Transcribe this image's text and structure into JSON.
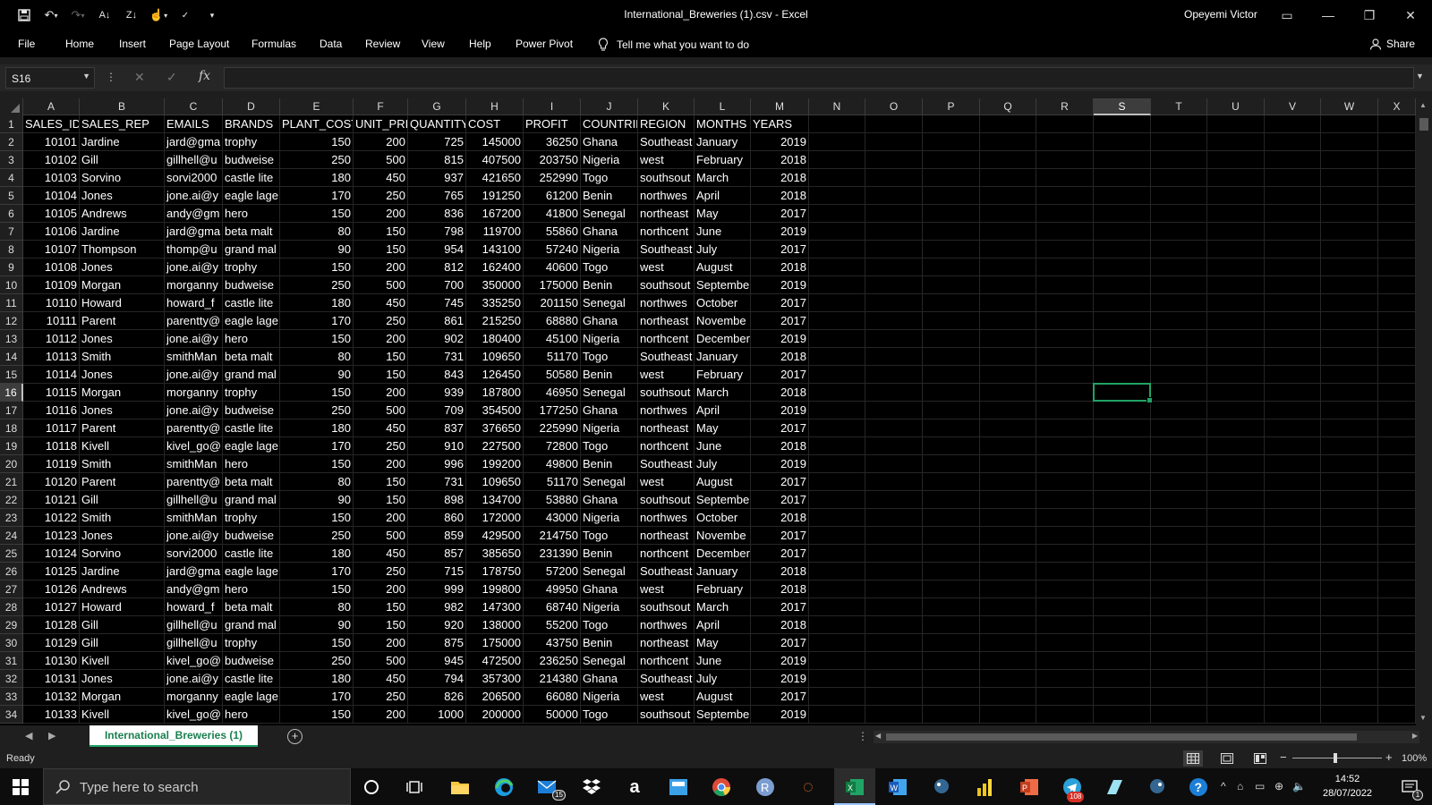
{
  "window": {
    "title": "International_Breweries (1).csv  -  Excel",
    "user": "Opeyemi Victor"
  },
  "ribbon_tabs": [
    "File",
    "Home",
    "Insert",
    "Page Layout",
    "Formulas",
    "Data",
    "Review",
    "View",
    "Help",
    "Power Pivot"
  ],
  "tell_me": "Tell me what you want to do",
  "share_label": "Share",
  "formula_bar": {
    "name_box": "S16",
    "formula": ""
  },
  "columns": [
    "A",
    "B",
    "C",
    "D",
    "E",
    "F",
    "G",
    "H",
    "I",
    "J",
    "K",
    "L",
    "M",
    "N",
    "O",
    "P",
    "Q",
    "R",
    "S",
    "T",
    "U",
    "V",
    "W",
    "X"
  ],
  "selected_column": "S",
  "selected_row": 16,
  "header_row": [
    "SALES_ID",
    "SALES_REP",
    "EMAILS",
    "BRANDS",
    "PLANT_COST",
    "UNIT_PRICE",
    "QUANTITY",
    "COST",
    "PROFIT",
    "COUNTRIES",
    "REGION",
    "MONTHS",
    "YEARS"
  ],
  "rows": [
    [
      "10101",
      "Jardine",
      "jard@gma",
      "trophy",
      "150",
      "200",
      "725",
      "145000",
      "36250",
      "Ghana",
      "Southeast",
      "January",
      "2019"
    ],
    [
      "10102",
      "Gill",
      "gillhell@u",
      "budweise",
      "250",
      "500",
      "815",
      "407500",
      "203750",
      "Nigeria",
      "west",
      "February",
      "2018"
    ],
    [
      "10103",
      "Sorvino",
      "sorvi2000",
      "castle lite",
      "180",
      "450",
      "937",
      "421650",
      "252990",
      "Togo",
      "southsout",
      "March",
      "2018"
    ],
    [
      "10104",
      "Jones",
      "jone.ai@y",
      "eagle lage",
      "170",
      "250",
      "765",
      "191250",
      "61200",
      "Benin",
      "northwes",
      "April",
      "2018"
    ],
    [
      "10105",
      "Andrews",
      "andy@gm",
      "hero",
      "150",
      "200",
      "836",
      "167200",
      "41800",
      "Senegal",
      "northeast",
      "May",
      "2017"
    ],
    [
      "10106",
      "Jardine",
      "jard@gma",
      "beta malt",
      "80",
      "150",
      "798",
      "119700",
      "55860",
      "Ghana",
      "northcent",
      "June",
      "2019"
    ],
    [
      "10107",
      "Thompson",
      "thomp@u",
      "grand mal",
      "90",
      "150",
      "954",
      "143100",
      "57240",
      "Nigeria",
      "Southeast",
      "July",
      "2017"
    ],
    [
      "10108",
      "Jones",
      "jone.ai@y",
      "trophy",
      "150",
      "200",
      "812",
      "162400",
      "40600",
      "Togo",
      "west",
      "August",
      "2018"
    ],
    [
      "10109",
      "Morgan",
      "morganny",
      "budweise",
      "250",
      "500",
      "700",
      "350000",
      "175000",
      "Benin",
      "southsout",
      "Septembe",
      "2019"
    ],
    [
      "10110",
      "Howard",
      "howard_f",
      "castle lite",
      "180",
      "450",
      "745",
      "335250",
      "201150",
      "Senegal",
      "northwes",
      "October",
      "2017"
    ],
    [
      "10111",
      "Parent",
      "parentty@",
      "eagle lage",
      "170",
      "250",
      "861",
      "215250",
      "68880",
      "Ghana",
      "northeast",
      "Novembe",
      "2017"
    ],
    [
      "10112",
      "Jones",
      "jone.ai@y",
      "hero",
      "150",
      "200",
      "902",
      "180400",
      "45100",
      "Nigeria",
      "northcent",
      "December",
      "2019"
    ],
    [
      "10113",
      "Smith",
      "smithMan",
      "beta malt",
      "80",
      "150",
      "731",
      "109650",
      "51170",
      "Togo",
      "Southeast",
      "January",
      "2018"
    ],
    [
      "10114",
      "Jones",
      "jone.ai@y",
      "grand mal",
      "90",
      "150",
      "843",
      "126450",
      "50580",
      "Benin",
      "west",
      "February",
      "2017"
    ],
    [
      "10115",
      "Morgan",
      "morganny",
      "trophy",
      "150",
      "200",
      "939",
      "187800",
      "46950",
      "Senegal",
      "southsout",
      "March",
      "2018"
    ],
    [
      "10116",
      "Jones",
      "jone.ai@y",
      "budweise",
      "250",
      "500",
      "709",
      "354500",
      "177250",
      "Ghana",
      "northwes",
      "April",
      "2019"
    ],
    [
      "10117",
      "Parent",
      "parentty@",
      "castle lite",
      "180",
      "450",
      "837",
      "376650",
      "225990",
      "Nigeria",
      "northeast",
      "May",
      "2017"
    ],
    [
      "10118",
      "Kivell",
      "kivel_go@",
      "eagle lage",
      "170",
      "250",
      "910",
      "227500",
      "72800",
      "Togo",
      "northcent",
      "June",
      "2018"
    ],
    [
      "10119",
      "Smith",
      "smithMan",
      "hero",
      "150",
      "200",
      "996",
      "199200",
      "49800",
      "Benin",
      "Southeast",
      "July",
      "2019"
    ],
    [
      "10120",
      "Parent",
      "parentty@",
      "beta malt",
      "80",
      "150",
      "731",
      "109650",
      "51170",
      "Senegal",
      "west",
      "August",
      "2017"
    ],
    [
      "10121",
      "Gill",
      "gillhell@u",
      "grand mal",
      "90",
      "150",
      "898",
      "134700",
      "53880",
      "Ghana",
      "southsout",
      "Septembe",
      "2017"
    ],
    [
      "10122",
      "Smith",
      "smithMan",
      "trophy",
      "150",
      "200",
      "860",
      "172000",
      "43000",
      "Nigeria",
      "northwes",
      "October",
      "2018"
    ],
    [
      "10123",
      "Jones",
      "jone.ai@y",
      "budweise",
      "250",
      "500",
      "859",
      "429500",
      "214750",
      "Togo",
      "northeast",
      "Novembe",
      "2017"
    ],
    [
      "10124",
      "Sorvino",
      "sorvi2000",
      "castle lite",
      "180",
      "450",
      "857",
      "385650",
      "231390",
      "Benin",
      "northcent",
      "December",
      "2017"
    ],
    [
      "10125",
      "Jardine",
      "jard@gma",
      "eagle lage",
      "170",
      "250",
      "715",
      "178750",
      "57200",
      "Senegal",
      "Southeast",
      "January",
      "2018"
    ],
    [
      "10126",
      "Andrews",
      "andy@gm",
      "hero",
      "150",
      "200",
      "999",
      "199800",
      "49950",
      "Ghana",
      "west",
      "February",
      "2018"
    ],
    [
      "10127",
      "Howard",
      "howard_f",
      "beta malt",
      "80",
      "150",
      "982",
      "147300",
      "68740",
      "Nigeria",
      "southsout",
      "March",
      "2017"
    ],
    [
      "10128",
      "Gill",
      "gillhell@u",
      "grand mal",
      "90",
      "150",
      "920",
      "138000",
      "55200",
      "Togo",
      "northwes",
      "April",
      "2018"
    ],
    [
      "10129",
      "Gill",
      "gillhell@u",
      "trophy",
      "150",
      "200",
      "875",
      "175000",
      "43750",
      "Benin",
      "northeast",
      "May",
      "2017"
    ],
    [
      "10130",
      "Kivell",
      "kivel_go@",
      "budweise",
      "250",
      "500",
      "945",
      "472500",
      "236250",
      "Senegal",
      "northcent",
      "June",
      "2019"
    ],
    [
      "10131",
      "Jones",
      "jone.ai@y",
      "castle lite",
      "180",
      "450",
      "794",
      "357300",
      "214380",
      "Ghana",
      "Southeast",
      "July",
      "2019"
    ],
    [
      "10132",
      "Morgan",
      "morganny",
      "eagle lage",
      "170",
      "250",
      "826",
      "206500",
      "66080",
      "Nigeria",
      "west",
      "August",
      "2017"
    ],
    [
      "10133",
      "Kivell",
      "kivel_go@",
      "hero",
      "150",
      "200",
      "1000",
      "200000",
      "50000",
      "Togo",
      "southsout",
      "Septembe",
      "2019"
    ]
  ],
  "sheet_tab": "International_Breweries (1)",
  "status": {
    "ready": "Ready",
    "zoom": "100%"
  },
  "taskbar": {
    "search_placeholder": "Type here to search",
    "time": "14:52",
    "date": "28/07/2022",
    "mail_badge": "15",
    "telegram_badge": "108",
    "notification_badge": "1"
  }
}
